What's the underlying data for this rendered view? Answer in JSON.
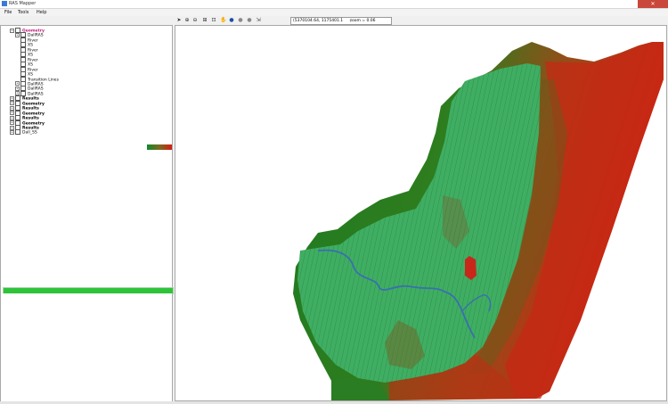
{
  "window": {
    "title": "RAS Mapper",
    "close_glyph": "✕"
  },
  "menu": [
    {
      "label": "File"
    },
    {
      "label": "Tools"
    },
    {
      "label": "Help"
    }
  ],
  "toolbar": {
    "icons": [
      "pointer-icon",
      "zoom-in-icon",
      "zoom-out-icon",
      "full-extent-icon",
      "zoom-window-icon",
      "pan-icon",
      "globe-icon",
      "back-icon",
      "forward-icon",
      "measure-icon"
    ],
    "coords": "(5370104.64, 1175401.1",
    "zoom_text": "zoom = 0.06"
  },
  "tree": [
    {
      "label": "Geometry",
      "indent": 1,
      "color": "#c0187a",
      "bold": true
    },
    {
      "label": "DallRAS",
      "indent": 2
    },
    {
      "label": "River",
      "indent": 3
    },
    {
      "label": "XS",
      "indent": 3
    },
    {
      "label": "River",
      "indent": 3
    },
    {
      "label": "XS",
      "indent": 3
    },
    {
      "label": "River",
      "indent": 3
    },
    {
      "label": "XS",
      "indent": 3
    },
    {
      "label": "River",
      "indent": 3
    },
    {
      "label": "XS",
      "indent": 3
    },
    {
      "label": "Transition Lines",
      "indent": 3
    },
    {
      "label": "DallRAS",
      "indent": 2
    },
    {
      "label": "DallRAS",
      "indent": 2
    },
    {
      "label": "DallRAS",
      "indent": 2
    },
    {
      "label": "Results",
      "indent": 1,
      "bold": true
    },
    {
      "label": "Geometry",
      "indent": 1,
      "bold": true
    },
    {
      "label": "Results",
      "indent": 1,
      "bold": true
    },
    {
      "label": "Geometry",
      "indent": 1,
      "bold": true
    },
    {
      "label": "Results",
      "indent": 1,
      "bold": true
    },
    {
      "label": "Geometry",
      "indent": 1,
      "bold": true
    },
    {
      "label": "Results",
      "indent": 1,
      "bold": true
    },
    {
      "label": "Dall_SS",
      "indent": 1
    }
  ],
  "progress": {
    "percent": 100
  },
  "colors": {
    "terrain_low": "#0f8a2a",
    "terrain_high": "#d41d12",
    "mesh_green": "#3ba65a",
    "river_blue": "#3a6fb0"
  }
}
